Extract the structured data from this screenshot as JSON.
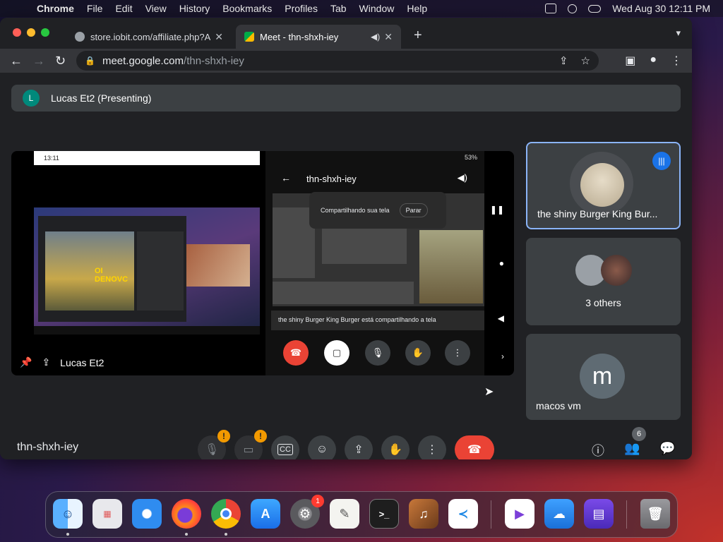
{
  "menubar": {
    "app_name": "Chrome",
    "items": [
      "File",
      "Edit",
      "View",
      "History",
      "Bookmarks",
      "Profiles",
      "Tab",
      "Window",
      "Help"
    ],
    "datetime": "Wed Aug 30  12:11 PM"
  },
  "browser": {
    "tabs": [
      {
        "title": "store.iobit.com/affiliate.php?AC"
      },
      {
        "title": "Meet - thn-shxh-iey"
      }
    ],
    "url_host": "meet.google.com",
    "url_path": "/thn-shxh-iey"
  },
  "meet": {
    "presenting_avatar_letter": "L",
    "presenting_label": "Lucas Et2 (Presenting)",
    "stage": {
      "presenter_name": "Lucas Et2",
      "left_status_time": "13:11",
      "overlay_text": "OI DENOVC",
      "phone_battery": "53%",
      "phone_meeting_title": "thn-shxh-iey",
      "popup_text": "Compartilhando sua tela",
      "popup_button": "Parar",
      "caption": "the shiny Burger King Burger está compartilhando a tela"
    },
    "tiles": [
      {
        "name": "the shiny Burger King Bur..."
      },
      {
        "name": "3 others"
      },
      {
        "name": "macos vm",
        "avatar_letter": "m"
      }
    ],
    "meeting_id": "thn-shxh-iey",
    "participants_count": "6"
  },
  "dock": {
    "settings_badge": "1"
  },
  "colors": {
    "meet_bg": "#202124",
    "surface": "#3c4043",
    "end_call": "#ea4335",
    "active_speaker": "#8ab4f8",
    "warning": "#f29900"
  }
}
